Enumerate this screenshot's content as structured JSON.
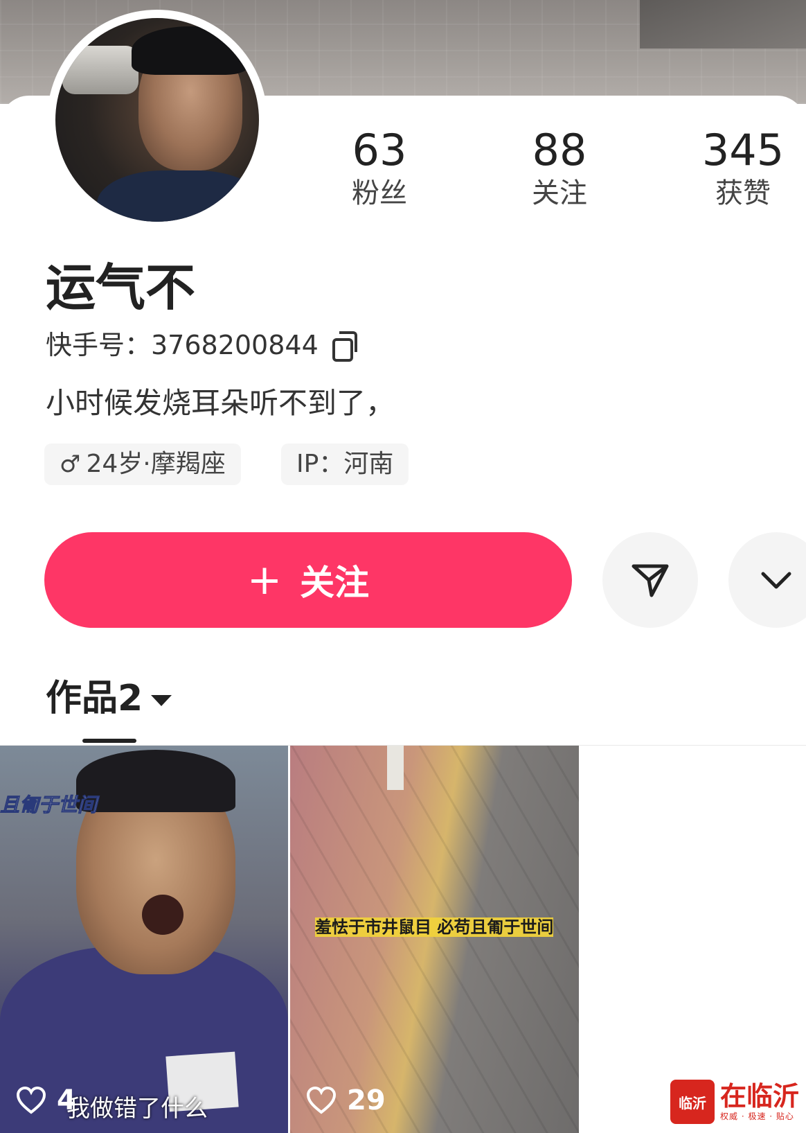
{
  "profile": {
    "name": "运气不",
    "id_label": "快手号：3768200844",
    "bio": "小时候发烧耳朵听不到了，",
    "tags": {
      "age": "24岁·摩羯座",
      "ip": "IP：河南"
    }
  },
  "stats": {
    "fans": {
      "value": "63",
      "label": "粉丝"
    },
    "following": {
      "value": "88",
      "label": "关注"
    },
    "likes": {
      "value": "345",
      "label": "获赞"
    }
  },
  "actions": {
    "follow_label": "关注",
    "share_icon": "send-icon",
    "more_icon": "chevron-down-icon"
  },
  "works": {
    "tab_label": "作品2",
    "items": [
      {
        "caption_top": "且匍于世间",
        "caption_bottom": "我做错了什么",
        "likes": "4"
      },
      {
        "caption": "羞怯于市井鼠目 必苟且匍于世间",
        "likes": "29"
      }
    ]
  },
  "watermark": {
    "logo_text": "临沂",
    "title": "在临沂",
    "subtitle": "权威 · 极速 · 贴心"
  },
  "colors": {
    "accent": "#fe3666",
    "watermark": "#d7261e"
  }
}
